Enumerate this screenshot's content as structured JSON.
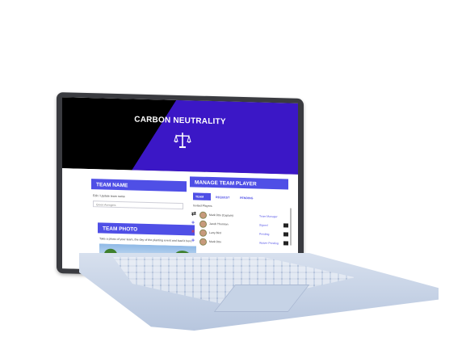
{
  "hero": {
    "title": "CARBON NEUTRALITY",
    "icon": "balance-scale-icon"
  },
  "team_name": {
    "heading": "TEAM NAME",
    "label": "Edit / Update team name",
    "value": "Green Avengers"
  },
  "team_photo": {
    "heading": "TEAM PHOTO",
    "description": "Take a photo of your team, the day of the planting event and load it here"
  },
  "manage": {
    "heading": "MANAGE TEAM PLAYER",
    "tabs": [
      {
        "label": "TEAM"
      },
      {
        "label": "REQUEST"
      },
      {
        "label": "PENDING"
      }
    ],
    "section_label": "Invited Players",
    "rows": [
      {
        "action": "⇄",
        "action_color": "#222222",
        "name": "Mark Otto (Captain)",
        "status": "Team Manager"
      },
      {
        "action": "+",
        "action_color": "#4f4fe6",
        "name": "Jacob Thornton",
        "status": "Signed"
      },
      {
        "action": "×",
        "action_color": "#e23b3b",
        "name": "Larry Bird",
        "status": "Pending"
      },
      {
        "action": "+",
        "action_color": "#4f4fe6",
        "name": "Mark Otto",
        "status": "Waiver Pending"
      }
    ]
  },
  "colors": {
    "accent": "#4f4fe6",
    "hero_purple": "#3b17c6",
    "hero_black": "#000000"
  }
}
